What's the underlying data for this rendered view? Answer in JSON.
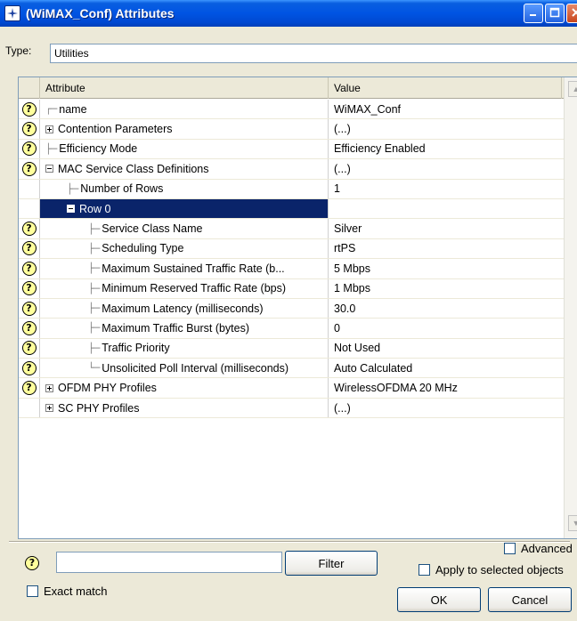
{
  "window": {
    "title": "(WiMAX_Conf) Attributes",
    "icons": {
      "app": "star-icon",
      "minimize": "minimize-icon",
      "maximize": "maximize-icon",
      "close": "close-icon"
    }
  },
  "type_label": "Type:",
  "type_value": "Utilities",
  "grid": {
    "headers": {
      "attribute": "Attribute",
      "value": "Value"
    },
    "rows": [
      {
        "help": true,
        "indent": 0,
        "tree": "┌─",
        "expander": "",
        "label": "name",
        "value": "WiMAX_Conf"
      },
      {
        "help": true,
        "indent": 0,
        "tree": "",
        "expander": "plus",
        "label": "Contention Parameters",
        "value": "(...)"
      },
      {
        "help": true,
        "indent": 0,
        "tree": "├─",
        "expander": "",
        "label": "Efficiency Mode",
        "value": "Efficiency Enabled"
      },
      {
        "help": true,
        "indent": 0,
        "tree": "",
        "expander": "minus",
        "label": "MAC Service Class Definitions",
        "value": "(...)"
      },
      {
        "help": false,
        "indent": 1,
        "tree": "├─",
        "expander": "",
        "label": "Number of Rows",
        "value": "1"
      },
      {
        "help": false,
        "indent": 1,
        "tree": "",
        "expander": "minus",
        "label": "Row 0",
        "value": "",
        "selected": true
      },
      {
        "help": true,
        "indent": 2,
        "tree": "├─",
        "expander": "",
        "label": "Service Class Name",
        "value": "Silver"
      },
      {
        "help": true,
        "indent": 2,
        "tree": "├─",
        "expander": "",
        "label": "Scheduling Type",
        "value": "rtPS"
      },
      {
        "help": true,
        "indent": 2,
        "tree": "├─",
        "expander": "",
        "label": "Maximum Sustained Traffic Rate (b...",
        "value": "5 Mbps"
      },
      {
        "help": true,
        "indent": 2,
        "tree": "├─",
        "expander": "",
        "label": "Minimum Reserved Traffic Rate (bps)",
        "value": "1 Mbps"
      },
      {
        "help": true,
        "indent": 2,
        "tree": "├─",
        "expander": "",
        "label": "Maximum Latency (milliseconds)",
        "value": "30.0"
      },
      {
        "help": true,
        "indent": 2,
        "tree": "├─",
        "expander": "",
        "label": "Maximum Traffic Burst (bytes)",
        "value": "0"
      },
      {
        "help": true,
        "indent": 2,
        "tree": "├─",
        "expander": "",
        "label": "Traffic Priority",
        "value": "Not Used"
      },
      {
        "help": true,
        "indent": 2,
        "tree": "└─",
        "expander": "",
        "label": "Unsolicited Poll Interval (milliseconds)",
        "value": "Auto Calculated"
      },
      {
        "help": true,
        "indent": 0,
        "tree": "",
        "expander": "plus",
        "label": "OFDM PHY Profiles",
        "value": "WirelessOFDMA 20 MHz"
      },
      {
        "help": false,
        "indent": 0,
        "tree": "",
        "expander": "plus",
        "label": "SC PHY Profiles",
        "value": "(...)"
      }
    ]
  },
  "bottom": {
    "filter_button": "Filter",
    "filter_value": "",
    "exact_match": "Exact match",
    "advanced": "Advanced",
    "apply_selected": "Apply to selected objects",
    "ok": "OK",
    "cancel": "Cancel"
  }
}
